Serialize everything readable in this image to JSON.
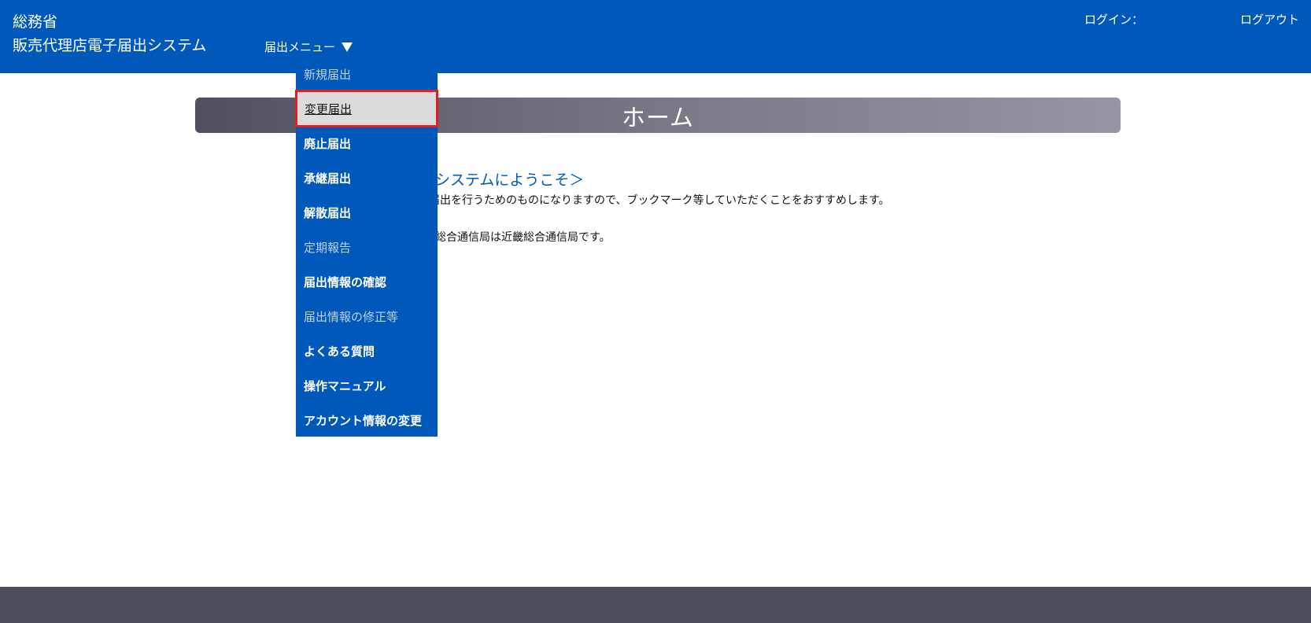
{
  "header": {
    "org": "総務省",
    "system_name": "販売代理店電子届出システム",
    "menu_label": "届出メニュー",
    "login_label": "ログイン：",
    "logout_label": "ログアウト"
  },
  "banner": {
    "title": "ホーム"
  },
  "content": {
    "welcome": "システムにようこそ＞",
    "line1": "届出を行うためのものになりますので、ブックマーク等していただくことをおすすめします。",
    "line2": "総合通信局は近畿総合通信局です。"
  },
  "dropdown": {
    "items": [
      {
        "label": "新規届出",
        "state": "disabled"
      },
      {
        "label": "変更届出",
        "state": "selected"
      },
      {
        "label": "廃止届出",
        "state": "enabled"
      },
      {
        "label": "承継届出",
        "state": "enabled"
      },
      {
        "label": "解散届出",
        "state": "enabled"
      },
      {
        "label": "定期報告",
        "state": "disabled"
      },
      {
        "label": "届出情報の確認",
        "state": "enabled"
      },
      {
        "label": "届出情報の修正等",
        "state": "disabled"
      },
      {
        "label": "よくある質問",
        "state": "enabled"
      },
      {
        "label": "操作マニュアル",
        "state": "enabled"
      },
      {
        "label": "アカウント情報の変更",
        "state": "enabled"
      }
    ]
  },
  "colors": {
    "header": "#0058bb",
    "footer": "#4d4f5c",
    "highlight_border": "#e02020"
  }
}
